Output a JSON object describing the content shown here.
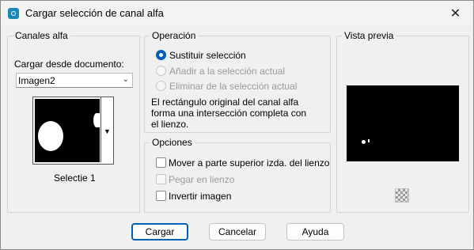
{
  "window": {
    "title": "Cargar selección de canal alfa",
    "close_glyph": "✕",
    "app_icon": "camera-icon"
  },
  "canales": {
    "group_title": "Canales alfa",
    "source_label": "Cargar desde documento:",
    "document_select": {
      "value": "Imagen2"
    },
    "thumbnail_caption": "Selectie 1"
  },
  "operacion": {
    "group_title": "Operación",
    "options": [
      {
        "label": "Sustituir selección",
        "checked": true,
        "enabled": true
      },
      {
        "label": "Añadir a la selección actual",
        "checked": false,
        "enabled": false
      },
      {
        "label": "Eliminar de la selección actual",
        "checked": false,
        "enabled": false
      }
    ],
    "description_lines": [
      "El rectángulo original del canal alfa",
      "forma una intersección completa con",
      "el lienzo."
    ]
  },
  "opciones": {
    "group_title": "Opciones",
    "checkboxes": [
      {
        "label": "Mover a parte superior izda. del lienzo",
        "checked": false,
        "enabled": true
      },
      {
        "label": "Pegar en lienzo",
        "checked": false,
        "enabled": false
      },
      {
        "label": "Invertir imagen",
        "checked": false,
        "enabled": true
      }
    ]
  },
  "vista": {
    "group_title": "Vista previa",
    "zoom_icon": "checker-zoom-icon"
  },
  "buttons": {
    "cargar": "Cargar",
    "cancelar": "Cancelar",
    "ayuda": "Ayuda"
  }
}
